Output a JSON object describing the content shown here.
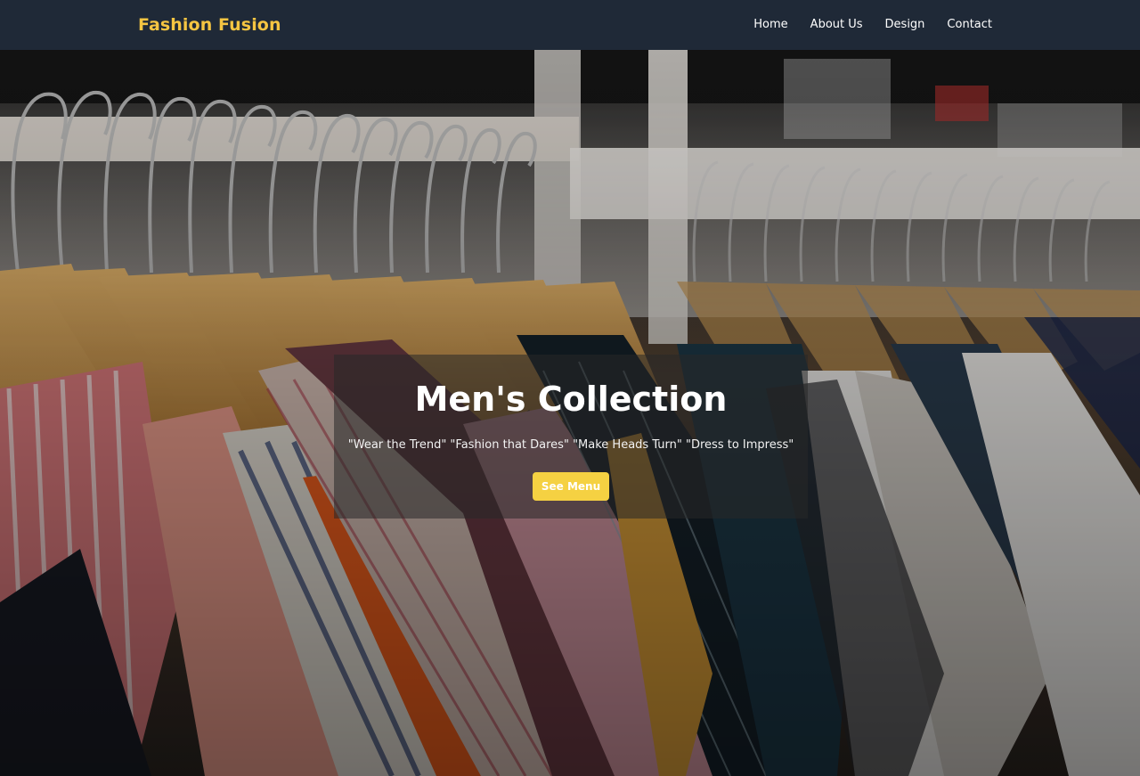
{
  "navbar": {
    "brand": "Fashion Fusion",
    "links": [
      {
        "label": "Home"
      },
      {
        "label": "About Us"
      },
      {
        "label": "Design"
      },
      {
        "label": "Contact"
      }
    ]
  },
  "hero": {
    "title": "Men's Collection",
    "tagline": "\"Wear the Trend\" \"Fashion that Dares\" \"Make Heads Turn\" \"Dress to Impress\"",
    "button_label": "See Menu"
  },
  "colors": {
    "navbar_bg": "#1f2937",
    "brand": "#f5c542",
    "button_bg": "#f5d142"
  }
}
